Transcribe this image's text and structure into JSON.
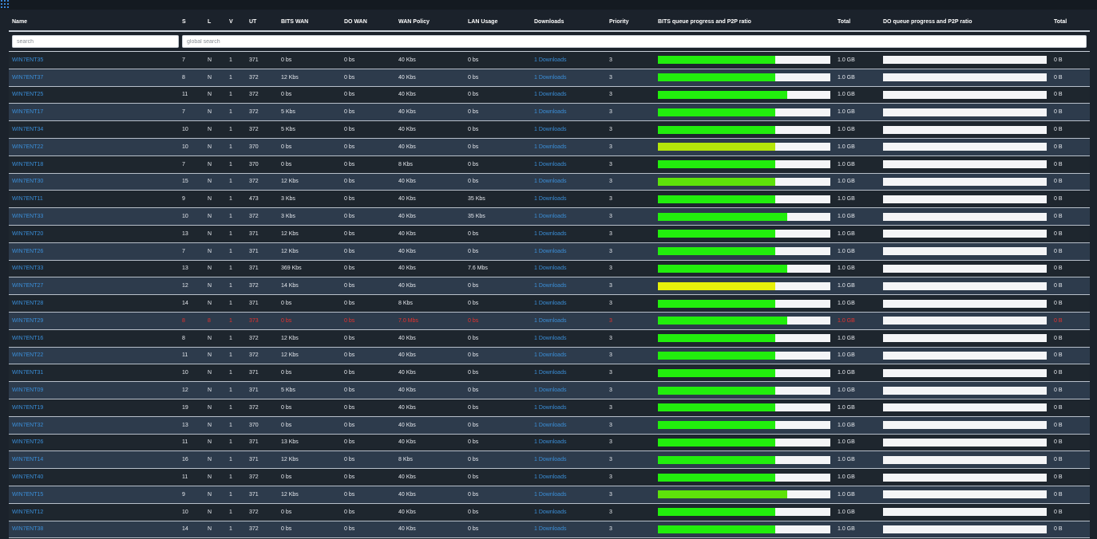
{
  "header": {
    "name": "Name",
    "s": "S",
    "l": "L",
    "v": "V",
    "ut": "UT",
    "bits_wan": "BITS WAN",
    "do_wan": "DO WAN",
    "wan_policy": "WAN Policy",
    "lan_usage": "LAN Usage",
    "downloads": "Downloads",
    "priority": "Priority",
    "bits_queue": "BITS queue progress and P2P ratio",
    "total": "Total",
    "do_queue": "DO queue progress and P2P ratio",
    "total2": "Total"
  },
  "search": {
    "placeholder": "search",
    "global_placeholder": "global search"
  },
  "colors": {
    "green": "#22ee0d",
    "lime": "#b5e60a",
    "yellow": "#e6f00a",
    "bright_green": "#5ee20a",
    "error_red": "#e8322d"
  },
  "rows": [
    {
      "name": "WIN7ENT35",
      "s": "7",
      "l": "N",
      "v": "1",
      "ut": "371",
      "bits_wan": "0 bs",
      "do_wan": "0 bs",
      "wan_policy": "40 Kbs",
      "lan_usage": "0 bs",
      "downloads": "1 Downloads",
      "priority": "3",
      "bits_progress": 0.68,
      "bits_color": "green",
      "total": "1.0 GB",
      "do_progress": 0,
      "total2": "0 B"
    },
    {
      "name": "WIN7ENT37",
      "s": "8",
      "l": "N",
      "v": "1",
      "ut": "372",
      "bits_wan": "12 Kbs",
      "do_wan": "0 bs",
      "wan_policy": "40 Kbs",
      "lan_usage": "0 bs",
      "downloads": "1 Downloads",
      "priority": "3",
      "bits_progress": 0.68,
      "bits_color": "green",
      "total": "1.0 GB",
      "do_progress": 0,
      "total2": "0 B"
    },
    {
      "name": "WIN7ENT25",
      "s": "11",
      "l": "N",
      "v": "1",
      "ut": "372",
      "bits_wan": "0 bs",
      "do_wan": "0 bs",
      "wan_policy": "40 Kbs",
      "lan_usage": "0 bs",
      "downloads": "1 Downloads",
      "priority": "3",
      "bits_progress": 0.75,
      "bits_color": "green",
      "total": "1.0 GB",
      "do_progress": 0,
      "total2": "0 B"
    },
    {
      "name": "WIN7ENT17",
      "s": "7",
      "l": "N",
      "v": "1",
      "ut": "372",
      "bits_wan": "5 Kbs",
      "do_wan": "0 bs",
      "wan_policy": "40 Kbs",
      "lan_usage": "0 bs",
      "downloads": "1 Downloads",
      "priority": "3",
      "bits_progress": 0.68,
      "bits_color": "green",
      "total": "1.0 GB",
      "do_progress": 0,
      "total2": "0 B"
    },
    {
      "name": "WIN7ENT34",
      "s": "10",
      "l": "N",
      "v": "1",
      "ut": "372",
      "bits_wan": "5 Kbs",
      "do_wan": "0 bs",
      "wan_policy": "40 Kbs",
      "lan_usage": "0 bs",
      "downloads": "1 Downloads",
      "priority": "3",
      "bits_progress": 0.68,
      "bits_color": "green",
      "total": "1.0 GB",
      "do_progress": 0,
      "total2": "0 B"
    },
    {
      "name": "WIN7ENT22",
      "s": "10",
      "l": "N",
      "v": "1",
      "ut": "370",
      "bits_wan": "0 bs",
      "do_wan": "0 bs",
      "wan_policy": "40 Kbs",
      "lan_usage": "0 bs",
      "downloads": "1 Downloads",
      "priority": "3",
      "bits_progress": 0.68,
      "bits_color": "lime",
      "total": "1.0 GB",
      "do_progress": 0,
      "total2": "0 B"
    },
    {
      "name": "WIN7ENT18",
      "s": "7",
      "l": "N",
      "v": "1",
      "ut": "370",
      "bits_wan": "0 bs",
      "do_wan": "0 bs",
      "wan_policy": "8 Kbs",
      "lan_usage": "0 bs",
      "downloads": "1 Downloads",
      "priority": "3",
      "bits_progress": 0.68,
      "bits_color": "green",
      "total": "1.0 GB",
      "do_progress": 0,
      "total2": "0 B"
    },
    {
      "name": "WIN7ENT30",
      "s": "15",
      "l": "N",
      "v": "1",
      "ut": "372",
      "bits_wan": "12 Kbs",
      "do_wan": "0 bs",
      "wan_policy": "40 Kbs",
      "lan_usage": "0 bs",
      "downloads": "1 Downloads",
      "priority": "3",
      "bits_progress": 0.68,
      "bits_color": "bright_green",
      "total": "1.0 GB",
      "do_progress": 0,
      "total2": "0 B"
    },
    {
      "name": "WIN7ENT11",
      "s": "9",
      "l": "N",
      "v": "1",
      "ut": "473",
      "bits_wan": "3 Kbs",
      "do_wan": "0 bs",
      "wan_policy": "40 Kbs",
      "lan_usage": "35 Kbs",
      "downloads": "1 Downloads",
      "priority": "3",
      "bits_progress": 0.68,
      "bits_color": "green",
      "total": "1.0 GB",
      "do_progress": 0,
      "total2": "0 B"
    },
    {
      "name": "WIN7ENT33",
      "s": "10",
      "l": "N",
      "v": "1",
      "ut": "372",
      "bits_wan": "3 Kbs",
      "do_wan": "0 bs",
      "wan_policy": "40 Kbs",
      "lan_usage": "35 Kbs",
      "downloads": "1 Downloads",
      "priority": "3",
      "bits_progress": 0.75,
      "bits_color": "green",
      "total": "1.0 GB",
      "do_progress": 0,
      "total2": "0 B"
    },
    {
      "name": "WIN7ENT20",
      "s": "13",
      "l": "N",
      "v": "1",
      "ut": "371",
      "bits_wan": "12 Kbs",
      "do_wan": "0 bs",
      "wan_policy": "40 Kbs",
      "lan_usage": "0 bs",
      "downloads": "1 Downloads",
      "priority": "3",
      "bits_progress": 0.68,
      "bits_color": "green",
      "total": "1.0 GB",
      "do_progress": 0,
      "total2": "0 B"
    },
    {
      "name": "WIN7ENT26",
      "s": "7",
      "l": "N",
      "v": "1",
      "ut": "371",
      "bits_wan": "12 Kbs",
      "do_wan": "0 bs",
      "wan_policy": "40 Kbs",
      "lan_usage": "0 bs",
      "downloads": "1 Downloads",
      "priority": "3",
      "bits_progress": 0.68,
      "bits_color": "green",
      "total": "1.0 GB",
      "do_progress": 0,
      "total2": "0 B"
    },
    {
      "name": "WIN7ENT33",
      "s": "13",
      "l": "N",
      "v": "1",
      "ut": "371",
      "bits_wan": "369 Kbs",
      "do_wan": "0 bs",
      "wan_policy": "40 Kbs",
      "lan_usage": "7.6 Mbs",
      "downloads": "1 Downloads",
      "priority": "3",
      "bits_progress": 0.75,
      "bits_color": "green",
      "total": "1.0 GB",
      "do_progress": 0,
      "total2": "0 B"
    },
    {
      "name": "WIN7ENT27",
      "s": "12",
      "l": "N",
      "v": "1",
      "ut": "372",
      "bits_wan": "14 Kbs",
      "do_wan": "0 bs",
      "wan_policy": "40 Kbs",
      "lan_usage": "0 bs",
      "downloads": "1 Downloads",
      "priority": "3",
      "bits_progress": 0.68,
      "bits_color": "yellow",
      "total": "1.0 GB",
      "do_progress": 0,
      "total2": "0 B"
    },
    {
      "name": "WIN7ENT28",
      "s": "14",
      "l": "N",
      "v": "1",
      "ut": "371",
      "bits_wan": "0 bs",
      "do_wan": "0 bs",
      "wan_policy": "8 Kbs",
      "lan_usage": "0 bs",
      "downloads": "1 Downloads",
      "priority": "3",
      "bits_progress": 0.68,
      "bits_color": "green",
      "total": "1.0 GB",
      "do_progress": 0,
      "total2": "0 B"
    },
    {
      "name": "WIN7ENT29",
      "s": "8",
      "l": "8",
      "v": "1",
      "ut": "373",
      "bits_wan": "0 bs",
      "do_wan": "0 bs",
      "wan_policy": "7.0 Mbs",
      "lan_usage": "0 bs",
      "downloads": "1 Downloads",
      "priority": "3",
      "bits_progress": 0.75,
      "bits_color": "green",
      "total": "1.0 GB",
      "do_progress": 0,
      "total2": "0 B",
      "error": true
    },
    {
      "name": "WIN7ENT16",
      "s": "8",
      "l": "N",
      "v": "1",
      "ut": "372",
      "bits_wan": "12 Kbs",
      "do_wan": "0 bs",
      "wan_policy": "40 Kbs",
      "lan_usage": "0 bs",
      "downloads": "1 Downloads",
      "priority": "3",
      "bits_progress": 0.68,
      "bits_color": "green",
      "total": "1.0 GB",
      "do_progress": 0,
      "total2": "0 B"
    },
    {
      "name": "WIN7ENT22",
      "s": "11",
      "l": "N",
      "v": "1",
      "ut": "372",
      "bits_wan": "12 Kbs",
      "do_wan": "0 bs",
      "wan_policy": "40 Kbs",
      "lan_usage": "0 bs",
      "downloads": "1 Downloads",
      "priority": "3",
      "bits_progress": 0.68,
      "bits_color": "green",
      "total": "1.0 GB",
      "do_progress": 0,
      "total2": "0 B"
    },
    {
      "name": "WIN7ENT31",
      "s": "10",
      "l": "N",
      "v": "1",
      "ut": "371",
      "bits_wan": "0 bs",
      "do_wan": "0 bs",
      "wan_policy": "40 Kbs",
      "lan_usage": "0 bs",
      "downloads": "1 Downloads",
      "priority": "3",
      "bits_progress": 0.68,
      "bits_color": "green",
      "total": "1.0 GB",
      "do_progress": 0,
      "total2": "0 B"
    },
    {
      "name": "WIN7ENT09",
      "s": "12",
      "l": "N",
      "v": "1",
      "ut": "371",
      "bits_wan": "5 Kbs",
      "do_wan": "0 bs",
      "wan_policy": "40 Kbs",
      "lan_usage": "0 bs",
      "downloads": "1 Downloads",
      "priority": "3",
      "bits_progress": 0.68,
      "bits_color": "green",
      "total": "1.0 GB",
      "do_progress": 0,
      "total2": "0 B"
    },
    {
      "name": "WIN7ENT19",
      "s": "19",
      "l": "N",
      "v": "1",
      "ut": "372",
      "bits_wan": "0 bs",
      "do_wan": "0 bs",
      "wan_policy": "40 Kbs",
      "lan_usage": "0 bs",
      "downloads": "1 Downloads",
      "priority": "3",
      "bits_progress": 0.68,
      "bits_color": "green",
      "total": "1.0 GB",
      "do_progress": 0,
      "total2": "0 B"
    },
    {
      "name": "WIN7ENT32",
      "s": "13",
      "l": "N",
      "v": "1",
      "ut": "370",
      "bits_wan": "0 bs",
      "do_wan": "0 bs",
      "wan_policy": "40 Kbs",
      "lan_usage": "0 bs",
      "downloads": "1 Downloads",
      "priority": "3",
      "bits_progress": 0.68,
      "bits_color": "green",
      "total": "1.0 GB",
      "do_progress": 0,
      "total2": "0 B"
    },
    {
      "name": "WIN7ENT26",
      "s": "11",
      "l": "N",
      "v": "1",
      "ut": "371",
      "bits_wan": "13 Kbs",
      "do_wan": "0 bs",
      "wan_policy": "40 Kbs",
      "lan_usage": "0 bs",
      "downloads": "1 Downloads",
      "priority": "3",
      "bits_progress": 0.68,
      "bits_color": "green",
      "total": "1.0 GB",
      "do_progress": 0,
      "total2": "0 B"
    },
    {
      "name": "WIN7ENT14",
      "s": "16",
      "l": "N",
      "v": "1",
      "ut": "371",
      "bits_wan": "12 Kbs",
      "do_wan": "0 bs",
      "wan_policy": "8 Kbs",
      "lan_usage": "0 bs",
      "downloads": "1 Downloads",
      "priority": "3",
      "bits_progress": 0.68,
      "bits_color": "green",
      "total": "1.0 GB",
      "do_progress": 0,
      "total2": "0 B"
    },
    {
      "name": "WIN7ENT40",
      "s": "11",
      "l": "N",
      "v": "1",
      "ut": "372",
      "bits_wan": "0 bs",
      "do_wan": "0 bs",
      "wan_policy": "40 Kbs",
      "lan_usage": "0 bs",
      "downloads": "1 Downloads",
      "priority": "3",
      "bits_progress": 0.68,
      "bits_color": "green",
      "total": "1.0 GB",
      "do_progress": 0,
      "total2": "0 B"
    },
    {
      "name": "WIN7ENT15",
      "s": "9",
      "l": "N",
      "v": "1",
      "ut": "371",
      "bits_wan": "12 Kbs",
      "do_wan": "0 bs",
      "wan_policy": "40 Kbs",
      "lan_usage": "0 bs",
      "downloads": "1 Downloads",
      "priority": "3",
      "bits_progress": 0.75,
      "bits_color": "bright_green",
      "total": "1.0 GB",
      "do_progress": 0,
      "total2": "0 B"
    },
    {
      "name": "WIN7ENT12",
      "s": "10",
      "l": "N",
      "v": "1",
      "ut": "372",
      "bits_wan": "0 bs",
      "do_wan": "0 bs",
      "wan_policy": "40 Kbs",
      "lan_usage": "0 bs",
      "downloads": "1 Downloads",
      "priority": "3",
      "bits_progress": 0.68,
      "bits_color": "green",
      "total": "1.0 GB",
      "do_progress": 0,
      "total2": "0 B"
    },
    {
      "name": "WIN7ENT38",
      "s": "14",
      "l": "N",
      "v": "1",
      "ut": "372",
      "bits_wan": "0 bs",
      "do_wan": "0 bs",
      "wan_policy": "40 Kbs",
      "lan_usage": "0 bs",
      "downloads": "1 Downloads",
      "priority": "3",
      "bits_progress": 0.68,
      "bits_color": "green",
      "total": "1.0 GB",
      "do_progress": 0,
      "total2": "0 B"
    }
  ]
}
